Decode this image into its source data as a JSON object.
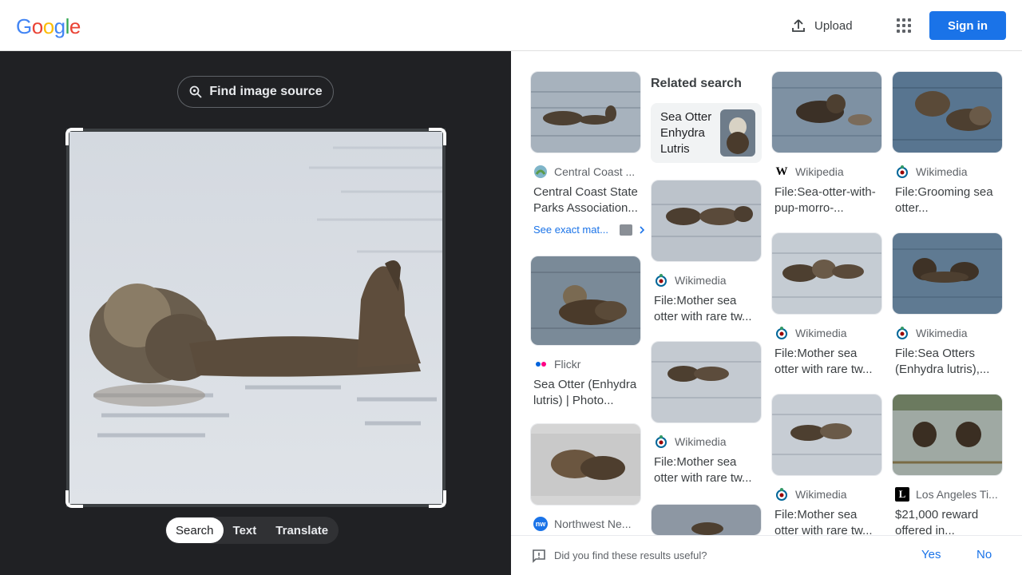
{
  "header": {
    "logo_letters": [
      "G",
      "o",
      "o",
      "g",
      "l",
      "e"
    ],
    "logo_colors": [
      "#4285f4",
      "#ea4335",
      "#fbbc05",
      "#4285f4",
      "#34a853",
      "#ea4335"
    ],
    "upload_label": "Upload",
    "signin_label": "Sign in"
  },
  "left": {
    "find_source_label": "Find image source",
    "tabs": [
      {
        "label": "Search",
        "active": true
      },
      {
        "label": "Text",
        "active": false
      },
      {
        "label": "Translate",
        "active": false
      }
    ]
  },
  "results": {
    "related_title": "Related search",
    "related_query": "Sea Otter Enhydra Lutris",
    "see_exact_label": "See exact mat...",
    "items": [
      {
        "source": "Central Coast ...",
        "source_icon": "central-coast-icon",
        "title": "Central Coast State Parks Association..."
      },
      {
        "source": "Flickr",
        "source_icon": "flickr-icon",
        "title": "Sea Otter (Enhydra lutris) | Photo..."
      },
      {
        "source": "Northwest Ne...",
        "source_icon": "nw-icon",
        "title": ""
      },
      {
        "source": "Wikimedia",
        "source_icon": "wikimedia-icon",
        "title": "File:Mother sea otter with rare tw..."
      },
      {
        "source": "Wikimedia",
        "source_icon": "wikimedia-icon",
        "title": "File:Mother sea otter with rare tw..."
      },
      {
        "source": "Wikipedia",
        "source_icon": "wikipedia-icon",
        "title": "File:Sea-otter-with-pup-morro-..."
      },
      {
        "source": "Wikimedia",
        "source_icon": "wikimedia-icon",
        "title": "File:Mother sea otter with rare tw..."
      },
      {
        "source": "Wikimedia",
        "source_icon": "wikimedia-icon",
        "title": "File:Mother sea otter with rare tw..."
      },
      {
        "source": "Wikimedia",
        "source_icon": "wikimedia-icon",
        "title": "File:Grooming sea otter..."
      },
      {
        "source": "Wikimedia",
        "source_icon": "wikimedia-icon",
        "title": "File:Sea Otters (Enhydra lutris),..."
      },
      {
        "source": "Los Angeles Ti...",
        "source_icon": "la-times-icon",
        "title": "$21,000 reward offered in..."
      }
    ]
  },
  "feedback": {
    "question": "Did you find these results useful?",
    "yes_label": "Yes",
    "no_label": "No"
  }
}
